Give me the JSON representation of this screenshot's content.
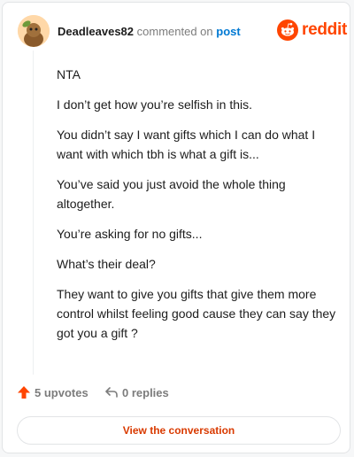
{
  "header": {
    "username": "Deadleaves82",
    "action": "commented on",
    "target": "post",
    "brand": "reddit",
    "brand_color": "#ff4500",
    "avatar_icon": "user-avatar"
  },
  "comment": {
    "paragraphs": [
      "NTA",
      "I don’t get how you’re selfish in this.",
      "You didn’t say I want gifts which I can do what I want with which tbh is what a gift is...",
      "You’ve said you just avoid the whole thing altogether.",
      "You’re asking for no gifts...",
      "What’s their deal?",
      "They want to give you gifts that give them more control whilst feeling good cause they can say they got you a gift ?"
    ]
  },
  "footer": {
    "upvotes_label": "5 upvotes",
    "replies_label": "0 replies",
    "upvote_icon": "upvote-arrow-icon",
    "reply_icon": "reply-arrow-icon"
  },
  "cta": {
    "label": "View the conversation",
    "color": "#d93a00"
  }
}
